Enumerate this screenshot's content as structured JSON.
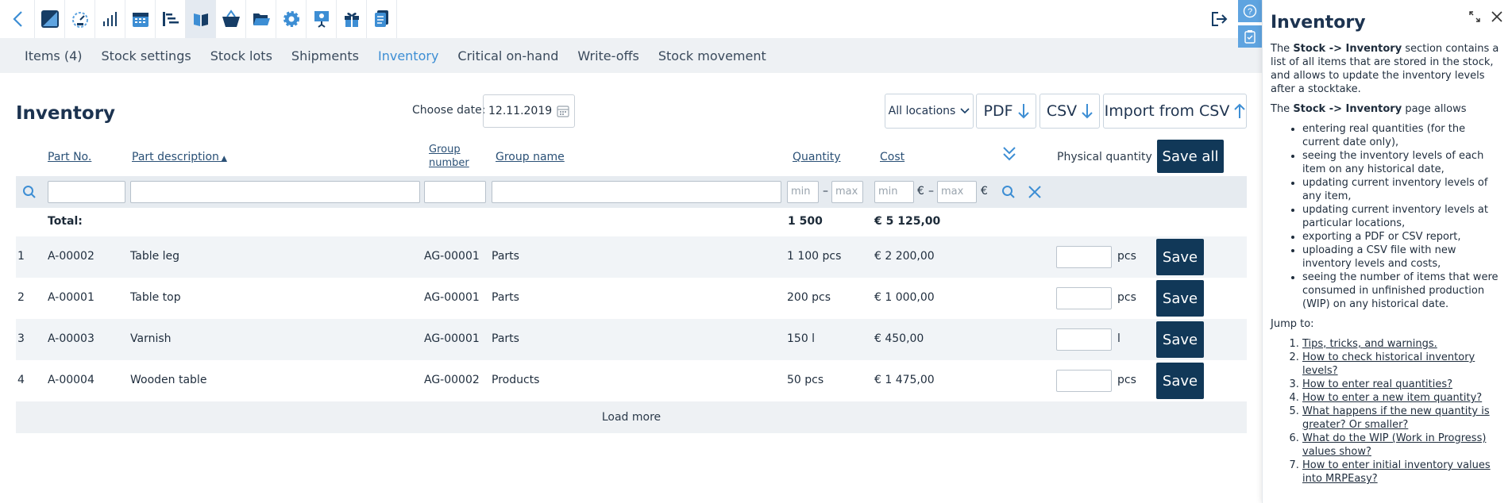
{
  "toolbar": {
    "icons": [
      "back-icon",
      "mrpeasy-logo-icon",
      "dashboard-icon",
      "stats-icon",
      "calendar-icon",
      "gantt-icon",
      "book-icon",
      "basket-icon",
      "folder-icon",
      "settings-icon",
      "presentation-icon",
      "gift-icon",
      "document-icon"
    ],
    "active_index": 6
  },
  "tabs": [
    "Items (4)",
    "Stock settings",
    "Stock lots",
    "Shipments",
    "Inventory",
    "Critical on-hand",
    "Write-offs",
    "Stock movement"
  ],
  "active_tab": "Inventory",
  "page": {
    "title": "Inventory",
    "choose_date_label": "Choose date:",
    "date_value": "12.11.2019",
    "locations_label": "All locations",
    "pdf_label": "PDF",
    "csv_label": "CSV",
    "import_label": "Import from CSV"
  },
  "table": {
    "headers": {
      "part_no": "Part No.",
      "part_description": "Part description",
      "group_number": "Group number",
      "group_name": "Group name",
      "quantity": "Quantity",
      "cost": "Cost",
      "physical_quantity": "Physical quantity",
      "save_all": "Save all"
    },
    "filter": {
      "min": "min",
      "max": "max",
      "dash": "–",
      "currency": "€"
    },
    "total": {
      "label": "Total:",
      "quantity": "1 500",
      "cost": "€ 5 125,00"
    },
    "rows": [
      {
        "n": "1",
        "part_no": "A-00002",
        "desc": "Table leg",
        "group_no": "AG-00001",
        "group": "Parts",
        "qty": "1 100 pcs",
        "cost": "€ 2 200,00",
        "unit": "pcs",
        "save": "Save"
      },
      {
        "n": "2",
        "part_no": "A-00001",
        "desc": "Table top",
        "group_no": "AG-00001",
        "group": "Parts",
        "qty": "200 pcs",
        "cost": "€ 1 000,00",
        "unit": "pcs",
        "save": "Save"
      },
      {
        "n": "3",
        "part_no": "A-00003",
        "desc": "Varnish",
        "group_no": "AG-00001",
        "group": "Parts",
        "qty": "150 l",
        "cost": "€ 450,00",
        "unit": "l",
        "save": "Save"
      },
      {
        "n": "4",
        "part_no": "A-00004",
        "desc": "Wooden table",
        "group_no": "AG-00002",
        "group": "Products",
        "qty": "50 pcs",
        "cost": "€ 1 475,00",
        "unit": "pcs",
        "save": "Save"
      }
    ],
    "load_more": "Load more"
  },
  "help": {
    "title": "Inventory",
    "intro_pre": "The ",
    "intro_bold": "Stock -> Inventory",
    "intro_post": " section contains a list of all items that are stored in the stock, and allows to update the inventory levels after a stocktake.",
    "allows_pre": "The ",
    "allows_bold": "Stock -> Inventory",
    "allows_post": " page allows",
    "bullets": [
      "entering real quantities (for the current date only),",
      "seeing the inventory levels of each item on any historical date,",
      "updating current inventory levels of any item,",
      "updating current inventory levels at particular locations,",
      "exporting a PDF or CSV report,",
      "uploading a CSV file with new inventory levels and costs,",
      "seeing the number of items that were consumed in unfinished production (WIP) on any historical date."
    ],
    "jump_to": "Jump to:",
    "links": [
      "Tips, tricks, and warnings.",
      "How to check historical inventory levels?",
      "How to enter real quantities?",
      "How to enter a new item quantity?",
      "What happens if the new quantity is greater? Or smaller?",
      "What do the WIP (Work in Progress) values show?",
      "How to enter initial inventory values into MRPEasy?"
    ]
  },
  "colors": {
    "accent": "#3d8ed4",
    "navy": "#113858",
    "tab_bg": "#eef1f4"
  }
}
